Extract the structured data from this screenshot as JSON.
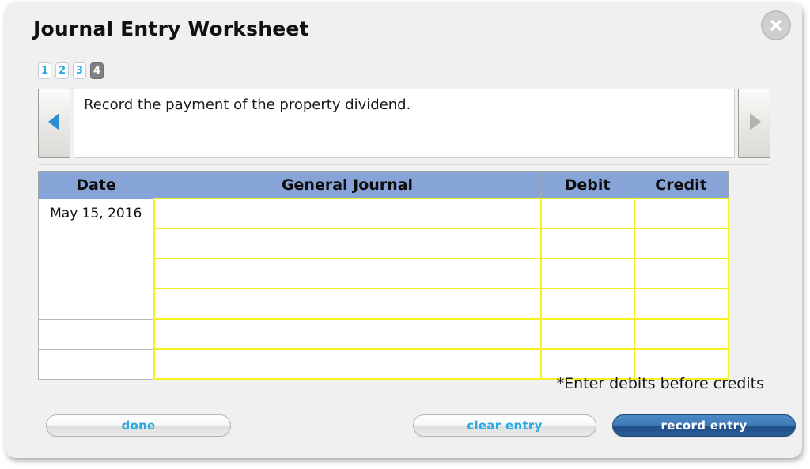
{
  "window": {
    "title": "Journal Entry Worksheet",
    "close_icon": "close-x-icon"
  },
  "tabs": {
    "items": [
      {
        "label": "1",
        "selected": false
      },
      {
        "label": "2",
        "selected": false
      },
      {
        "label": "3",
        "selected": false
      },
      {
        "label": "4",
        "selected": true
      }
    ]
  },
  "instruction": {
    "text": "Record the payment of the property dividend.",
    "prev_icon": "triangle-left-icon",
    "next_icon": "triangle-right-icon",
    "prev_enabled": true,
    "next_enabled": false
  },
  "table": {
    "headers": [
      "Date",
      "General Journal",
      "Debit",
      "Credit"
    ],
    "rows": [
      {
        "date": "May 15, 2016",
        "general_journal": "",
        "debit": "",
        "credit": ""
      },
      {
        "date": "",
        "general_journal": "",
        "debit": "",
        "credit": ""
      },
      {
        "date": "",
        "general_journal": "",
        "debit": "",
        "credit": ""
      },
      {
        "date": "",
        "general_journal": "",
        "debit": "",
        "credit": ""
      },
      {
        "date": "",
        "general_journal": "",
        "debit": "",
        "credit": ""
      },
      {
        "date": "",
        "general_journal": "",
        "debit": "",
        "credit": ""
      }
    ]
  },
  "footnote": "*Enter debits before credits",
  "buttons": {
    "done": "done",
    "clear_entry": "clear entry",
    "record_entry": "record entry"
  },
  "colors": {
    "panel_bg": "#f0f0f0",
    "header_blue": "#87a4d8",
    "input_border_yellow": "#f5f11f",
    "link_blue": "#29abe2",
    "primary_blue": "#2a5b96",
    "tab_selected_gray": "#808080"
  }
}
